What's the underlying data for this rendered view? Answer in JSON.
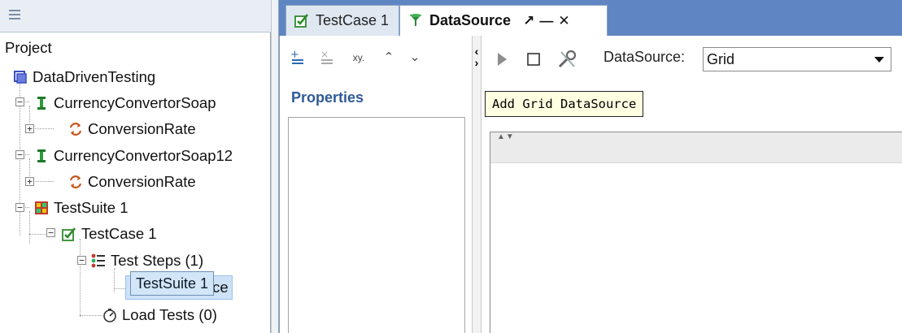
{
  "navigator": {
    "menu_icon": "menu-lines-icon",
    "tree": [
      {
        "label": "Project",
        "icon": ""
      },
      {
        "label": "DataDrivenTesting",
        "icon": "project-icon"
      },
      {
        "label": "CurrencyConvertorSoap",
        "icon": "interface-icon"
      },
      {
        "label": "ConversionRate",
        "icon": "operation-icon"
      },
      {
        "label": "CurrencyConvertorSoap12",
        "icon": "interface-icon"
      },
      {
        "label": "ConversionRate",
        "icon": "operation-icon"
      },
      {
        "label": "TestSuite 1",
        "icon": "testsuite-icon"
      },
      {
        "label": "TestCase 1",
        "icon": "testcase-icon"
      },
      {
        "label": "Test Steps (1)",
        "icon": "teststeps-icon"
      },
      {
        "label": "DataSource",
        "icon": "datasource-icon"
      },
      {
        "label": "Load Tests (0)",
        "icon": "loadtest-icon"
      }
    ],
    "drag_tooltip": "TestSuite 1"
  },
  "tabs": [
    {
      "label": "TestCase 1",
      "icon": "testcase-icon"
    },
    {
      "label": "DataSource",
      "icon": "datasource-icon",
      "controls": [
        "pin-icon",
        "minimize-icon",
        "close-icon"
      ]
    }
  ],
  "editor": {
    "left_toolbar": [
      "add-property-icon",
      "remove-property-icon",
      "rename-xy-icon",
      "move-up-icon",
      "move-down-icon"
    ],
    "properties_title": "Properties",
    "right_toolbar": [
      "run-icon",
      "stop-icon",
      "options-icon"
    ],
    "datasource_label": "DataSource:",
    "datasource_value": "Grid",
    "tooltip": "Add Grid DataSource"
  },
  "colors": {
    "tab_strip": "#5f86c2",
    "properties_title": "#2d5b97",
    "selection": "#cde2f7",
    "tooltip_bg": "#ffffe1"
  }
}
